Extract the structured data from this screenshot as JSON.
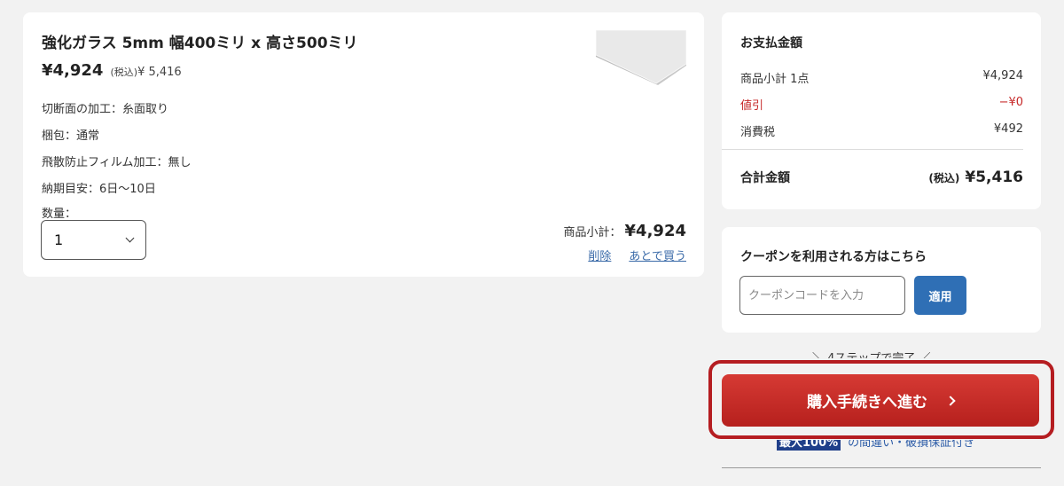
{
  "product": {
    "title": "強化ガラス 5mm 幅400ミリ x 高さ500ミリ",
    "price": "¥4,924",
    "tax_label": "(税込)",
    "tax_price": "¥ 5,416",
    "specs": [
      "切断面の加工：糸面取り",
      "梱包：通常",
      "飛散防止フィルム加工：無し",
      "納期目安：6日～10日"
    ],
    "quantity_label": "数量：",
    "quantity_value": "1",
    "subtotal_label": "商品小計：",
    "subtotal_value": "¥4,924",
    "delete_link": "削除",
    "save_later_link": "あとで買う",
    "thumbnail_icon": "glass-panel-image"
  },
  "summary": {
    "title": "お支払金額",
    "rows": [
      {
        "label": "商品小計 1点",
        "value": "¥4,924"
      },
      {
        "label": "値引",
        "value": "−¥0"
      },
      {
        "label": "消費税",
        "value": "¥492"
      }
    ],
    "total_label": "合計金額",
    "total_tax_label": "(税込)",
    "total_value": "¥5,416",
    "discount_color": "#c62828"
  },
  "coupon": {
    "title": "クーポンを利用される方はこちら",
    "placeholder": "クーポンコードを入力",
    "apply_label": "適用"
  },
  "checkout": {
    "steps_note": "＼ 4ステップで完了 ／",
    "button_label": "購入手続きへ進む",
    "guarantee_badge": "最大100%",
    "guarantee_text": "の間違い・破損保証付き",
    "accent_color": "#b51d21"
  }
}
